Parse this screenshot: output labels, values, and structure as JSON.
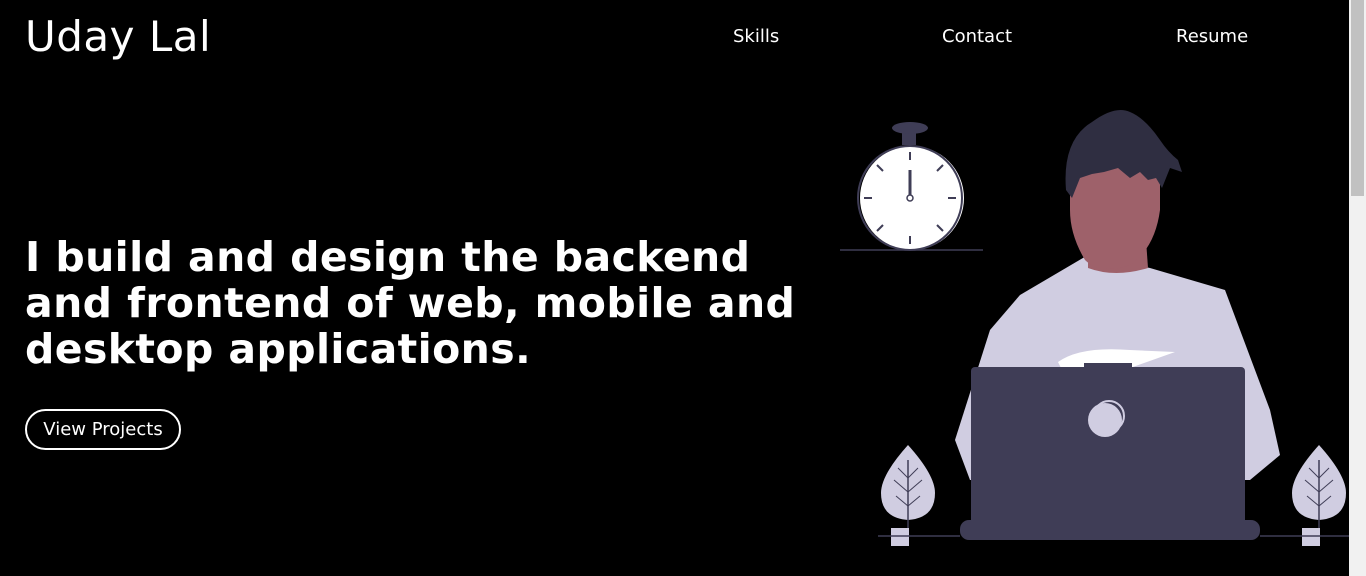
{
  "header": {
    "brand": "Uday Lal",
    "nav": {
      "skills": "Skills",
      "contact": "Contact",
      "resume": "Resume"
    }
  },
  "hero": {
    "headline": "I build and design the backend and frontend of web, mobile and desktop applications.",
    "cta_label": "View Projects",
    "illustration_icons": [
      "person-at-laptop",
      "stopwatch-icon",
      "plant-icon"
    ]
  },
  "colors": {
    "background": "#000000",
    "text": "#ffffff",
    "illustration_dark": "#3f3d56",
    "illustration_light": "#d0cde1",
    "skin": "#9e616a",
    "hair": "#2f2e41"
  }
}
